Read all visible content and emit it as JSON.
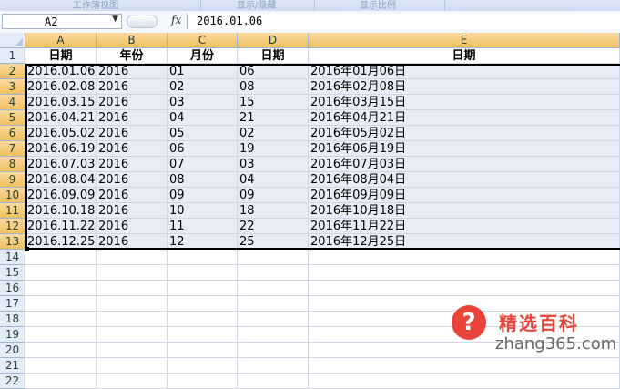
{
  "ribbon": {
    "groups": [
      "工作簿视图",
      "显示/隐藏",
      "显示比例"
    ]
  },
  "formula_bar": {
    "name_box": "A2",
    "fx_label": "fx",
    "formula": "2016.01.06"
  },
  "columns": [
    "A",
    "B",
    "C",
    "D",
    "E"
  ],
  "row_numbers": [
    "1",
    "2",
    "3",
    "4",
    "5",
    "6",
    "7",
    "8",
    "9",
    "10",
    "11",
    "12",
    "13",
    "14",
    "15",
    "16",
    "17",
    "18",
    "19",
    "20",
    "21",
    "22"
  ],
  "header_row": [
    "日期",
    "年份",
    "月份",
    "日期",
    "日期"
  ],
  "rows": [
    [
      "2016.01.06",
      "2016",
      "01",
      "06",
      "2016年01月06日"
    ],
    [
      "2016.02.08",
      "2016",
      "02",
      "08",
      "2016年02月08日"
    ],
    [
      "2016.03.15",
      "2016",
      "03",
      "15",
      "2016年03月15日"
    ],
    [
      "2016.04.21",
      "2016",
      "04",
      "21",
      "2016年04月21日"
    ],
    [
      "2016.05.02",
      "2016",
      "05",
      "02",
      "2016年05月02日"
    ],
    [
      "2016.06.19",
      "2016",
      "06",
      "19",
      "2016年06月19日"
    ],
    [
      "2016.07.03",
      "2016",
      "07",
      "03",
      "2016年07月03日"
    ],
    [
      "2016.08.04",
      "2016",
      "08",
      "04",
      "2016年08月04日"
    ],
    [
      "2016.09.09",
      "2016",
      "09",
      "09",
      "2016年09月09日"
    ],
    [
      "2016.10.18",
      "2016",
      "10",
      "18",
      "2016年10月18日"
    ],
    [
      "2016.11.22",
      "2016",
      "11",
      "22",
      "2016年11月22日"
    ],
    [
      "2016.12.25",
      "2016",
      "12",
      "25",
      "2016年12月25日"
    ]
  ],
  "watermark": {
    "icon": "question-mark-icon",
    "icon_glyph": "?",
    "brand": "精选百科",
    "domain": "zhang365.com"
  },
  "colors": {
    "selected_header": "#f1c15f",
    "selection_fill": "#e8ecf6",
    "watermark_red": "#e9433a"
  }
}
